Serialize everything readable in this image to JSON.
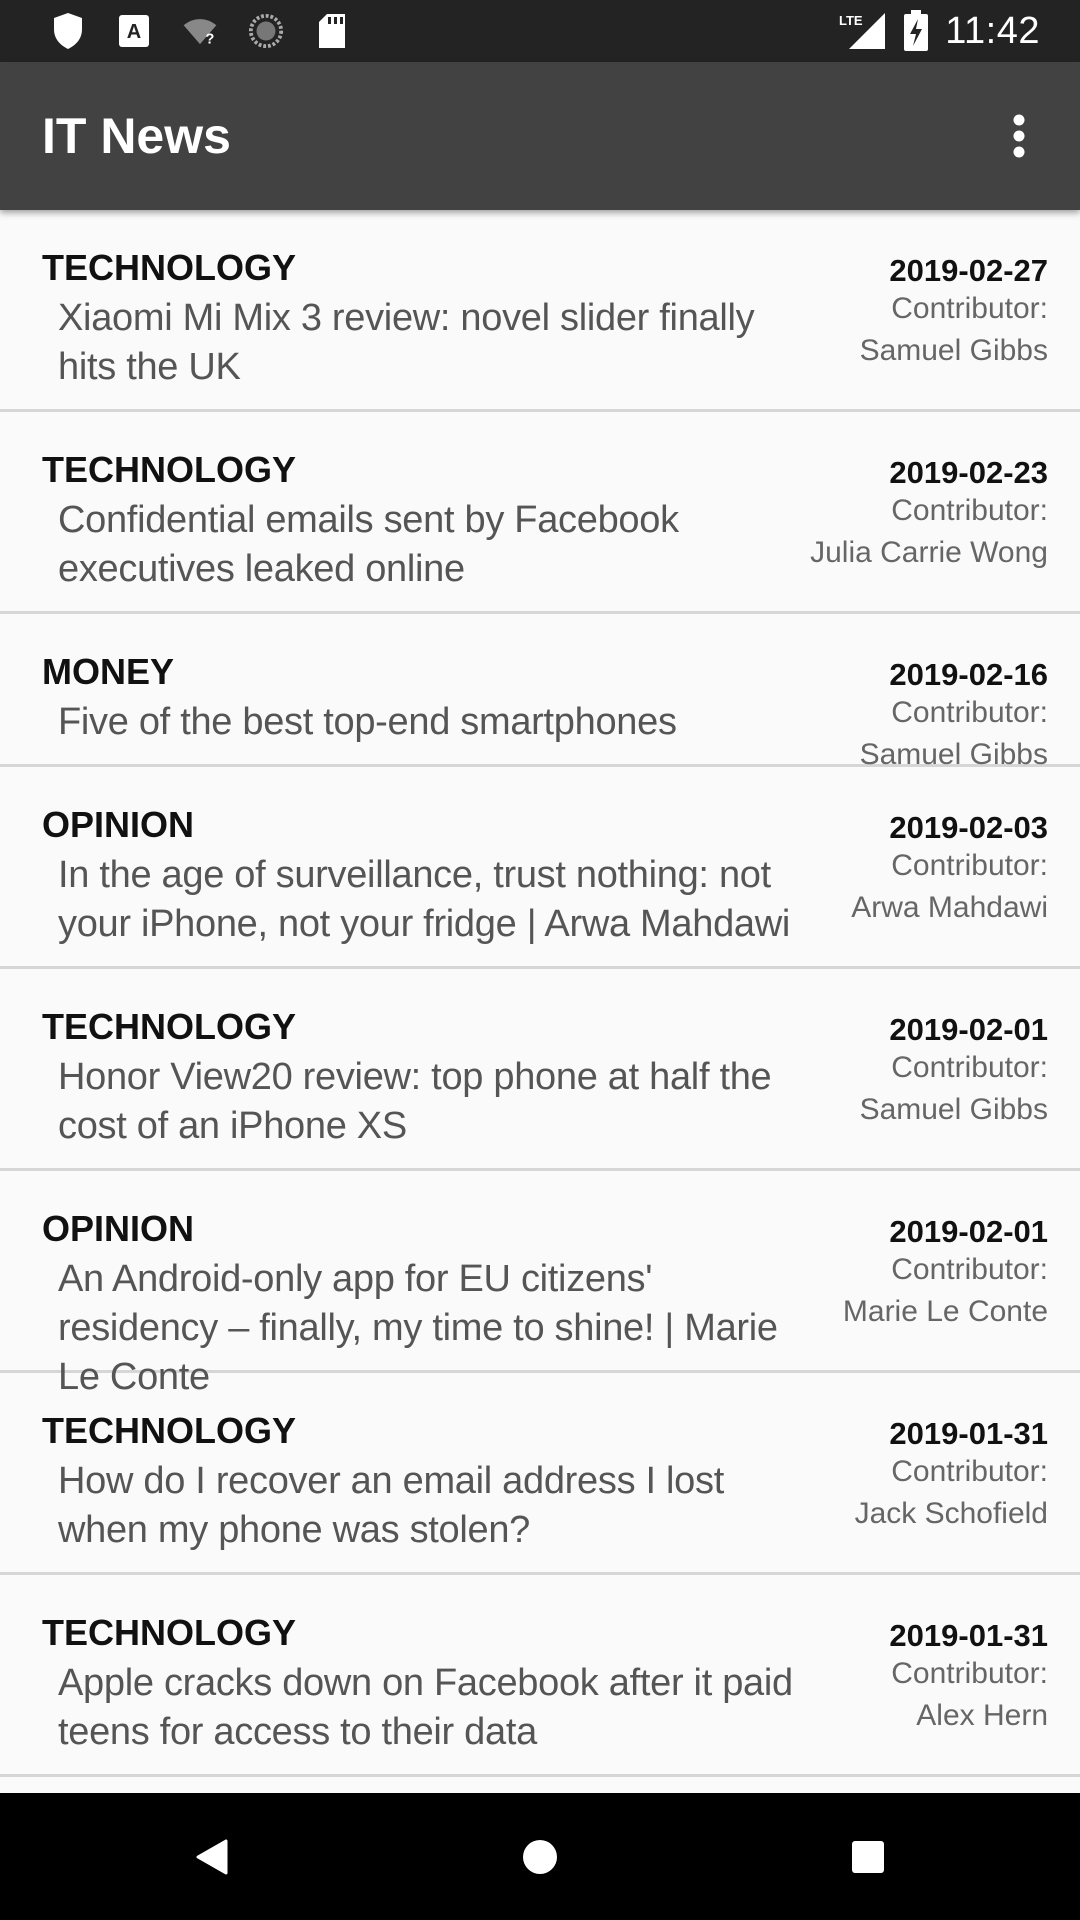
{
  "status_bar": {
    "time": "11:42",
    "network": "LTE",
    "icons": [
      "shield-icon",
      "a-notification-icon",
      "wifi-question-icon",
      "sync-icon",
      "sd-card-icon",
      "signal-icon",
      "battery-charging-icon"
    ]
  },
  "app_bar": {
    "title": "IT News",
    "overflow_icon": "more-vert-icon"
  },
  "articles": [
    {
      "section": "TECHNOLOGY",
      "title": "Xiaomi Mi Mix 3 review: novel slider finally hits the UK",
      "date": "2019-02-27",
      "contributor_label": "Contributor:",
      "contributor": "Samuel Gibbs"
    },
    {
      "section": "TECHNOLOGY",
      "title": "Confidential emails sent by Facebook executives leaked online",
      "date": "2019-02-23",
      "contributor_label": "Contributor:",
      "contributor": "Julia Carrie Wong"
    },
    {
      "section": "MONEY",
      "title": "Five of the best top-end smartphones",
      "date": "2019-02-16",
      "contributor_label": "Contributor:",
      "contributor": "Samuel Gibbs"
    },
    {
      "section": "OPINION",
      "title": "In the age of surveillance, trust nothing: not your iPhone, not your fridge | Arwa Mahdawi",
      "date": "2019-02-03",
      "contributor_label": "Contributor:",
      "contributor": "Arwa Mahdawi"
    },
    {
      "section": "TECHNOLOGY",
      "title": "Honor View20 review: top phone at half the cost of an iPhone XS",
      "date": "2019-02-01",
      "contributor_label": "Contributor:",
      "contributor": "Samuel Gibbs"
    },
    {
      "section": "OPINION",
      "title": "An Android-only app for EU citizens' residency – finally, my time to shine! | Marie Le Conte",
      "date": "2019-02-01",
      "contributor_label": "Contributor:",
      "contributor": "Marie Le Conte"
    },
    {
      "section": "TECHNOLOGY",
      "title": "How do I recover an email address I lost when my phone was stolen?",
      "date": "2019-01-31",
      "contributor_label": "Contributor:",
      "contributor": "Jack Schofield"
    },
    {
      "section": "TECHNOLOGY",
      "title": "Apple cracks down on Facebook after it paid teens for access to their data",
      "date": "2019-01-31",
      "contributor_label": "Contributor:",
      "contributor": "Alex Hern"
    }
  ],
  "nav_bar": {
    "icons": [
      "back-icon",
      "home-icon",
      "recents-icon"
    ]
  }
}
